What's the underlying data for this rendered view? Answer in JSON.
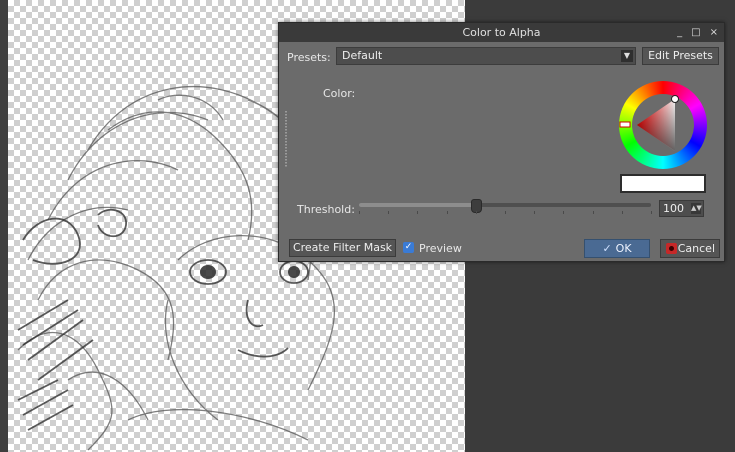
{
  "dialog": {
    "title": "Color to Alpha",
    "titlebar_buttons": {
      "minimize": "_",
      "maximize": "□",
      "close": "×"
    },
    "presets_label": "Presets:",
    "presets_value": "Default",
    "edit_presets": "Edit Presets",
    "color_label": "Color:",
    "selected_color": "#ffffff",
    "threshold_label": "Threshold:",
    "threshold_value": "100",
    "threshold_slider_fraction": 0.4,
    "create_filter_mask": "Create Filter Mask",
    "preview_label": "Preview",
    "preview_checked": true,
    "ok_label": "OK",
    "cancel_label": "Cancel"
  },
  "icons": {
    "dropdown": "chevron-down-icon",
    "spin": "spin-arrows-icon",
    "ok": "checkmark-icon",
    "cancel": "cancel-icon",
    "checkbox": "checkmark-icon"
  },
  "colors": {
    "ok_button": "#4a6a93",
    "checkbox": "#3a7bd5",
    "cancel_icon": "#c62828",
    "dialog_bg": "#6b6b6b"
  }
}
